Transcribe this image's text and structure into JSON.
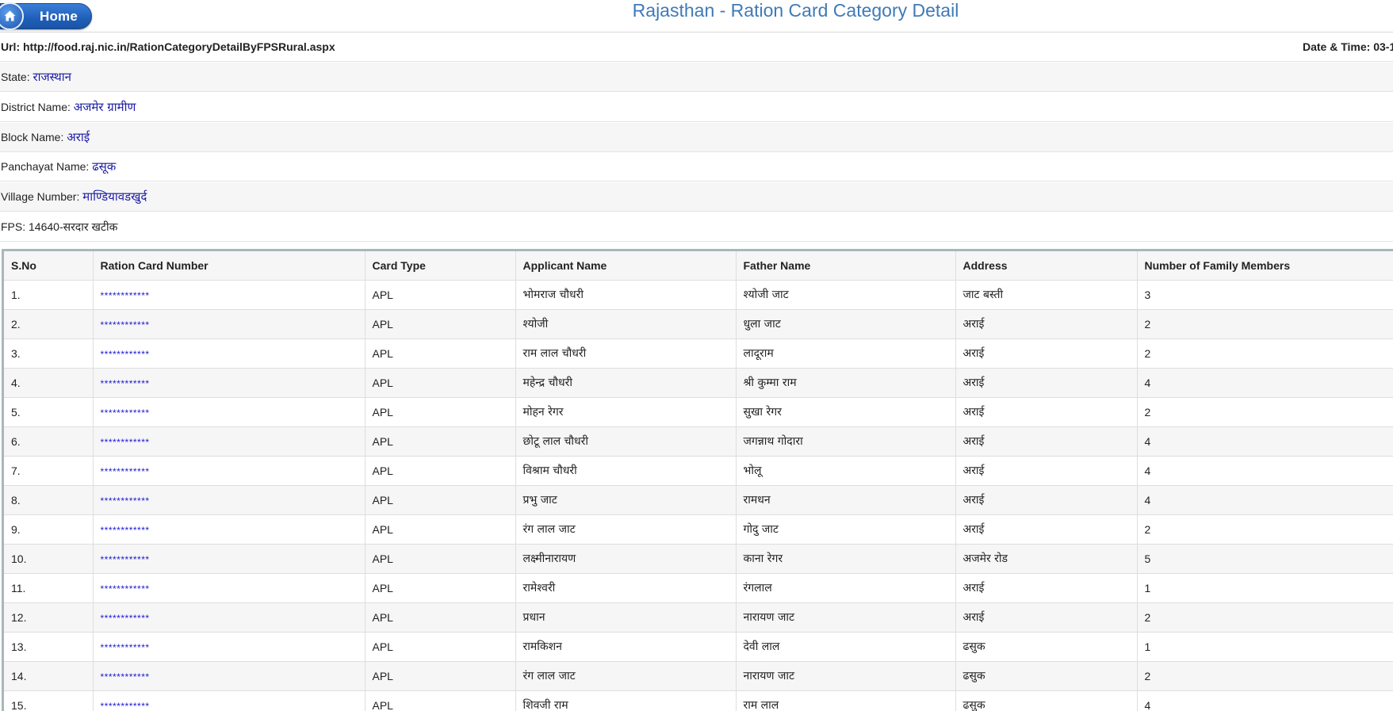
{
  "header": {
    "home_label": "Home",
    "title": "Rajasthan - Ration Card Category Detail"
  },
  "url_row": {
    "url_text": "Url: http://food.raj.nic.in/RationCategoryDetailByFPSRural.aspx",
    "datetime_text": "Date & Time: 03-1"
  },
  "info": {
    "state_label": "State:",
    "state_value": "राजस्थान",
    "district_label": "District Name:",
    "district_value": "अजमेर  ग्रामीण",
    "block_label": "Block Name:",
    "block_value": "अराई",
    "panchayat_label": "Panchayat Name:",
    "panchayat_value": "ढसूक",
    "village_label": "Village Number:",
    "village_value": "माण्डियावडखुर्द",
    "fps_label": "FPS:",
    "fps_value": "14640-सरदार खटीक"
  },
  "table": {
    "headers": [
      "S.No",
      "Ration Card Number",
      "Card Type",
      "Applicant Name",
      "Father Name",
      "Address",
      "Number of Family Members"
    ],
    "rows": [
      [
        "1.",
        "************",
        "APL",
        "भोमराज चौधरी",
        "श्योजी जाट",
        "जाट बस्ती",
        "3"
      ],
      [
        "2.",
        "************",
        "APL",
        "श्योजी",
        "धुला जाट",
        "अराई",
        "2"
      ],
      [
        "3.",
        "************",
        "APL",
        "राम लाल चौधरी",
        "लादूराम",
        "अराई",
        "2"
      ],
      [
        "4.",
        "************",
        "APL",
        "महेन्द्र चौधरी",
        "श्री कुम्मा राम",
        "अराई",
        "4"
      ],
      [
        "5.",
        "************",
        "APL",
        "मोहन रेगर",
        "सुखा रेगर",
        "अराई",
        "2"
      ],
      [
        "6.",
        "************",
        "APL",
        "छोटू लाल चौधरी",
        "जगन्नाथ गोदारा",
        "अराई",
        "4"
      ],
      [
        "7.",
        "************",
        "APL",
        "विश्राम चौधरी",
        "भोलू",
        "अराई",
        "4"
      ],
      [
        "8.",
        "************",
        "APL",
        "प्रभु जाट",
        "रामधन",
        "अराई",
        "4"
      ],
      [
        "9.",
        "************",
        "APL",
        "रंग लाल जाट",
        "गोदु जाट",
        "अराई",
        "2"
      ],
      [
        "10.",
        "************",
        "APL",
        "लक्ष्मीनारायण",
        "काना रेगर",
        "अजमेर रोड",
        "5"
      ],
      [
        "11.",
        "************",
        "APL",
        "रामेश्वरी",
        "रंगलाल",
        "अराई",
        "1"
      ],
      [
        "12.",
        "************",
        "APL",
        "प्रधान",
        "नारायण जाट",
        "अराई",
        "2"
      ],
      [
        "13.",
        "************",
        "APL",
        "रामकिशन",
        "देवी लाल",
        "ढसुक",
        "1"
      ],
      [
        "14.",
        "************",
        "APL",
        "रंग लाल जाट",
        "नारायण जाट",
        "ढसुक",
        "2"
      ],
      [
        "15.",
        "************",
        "APL",
        "शिवजी राम",
        "राम लाल",
        "ढसुक",
        "4"
      ]
    ]
  }
}
